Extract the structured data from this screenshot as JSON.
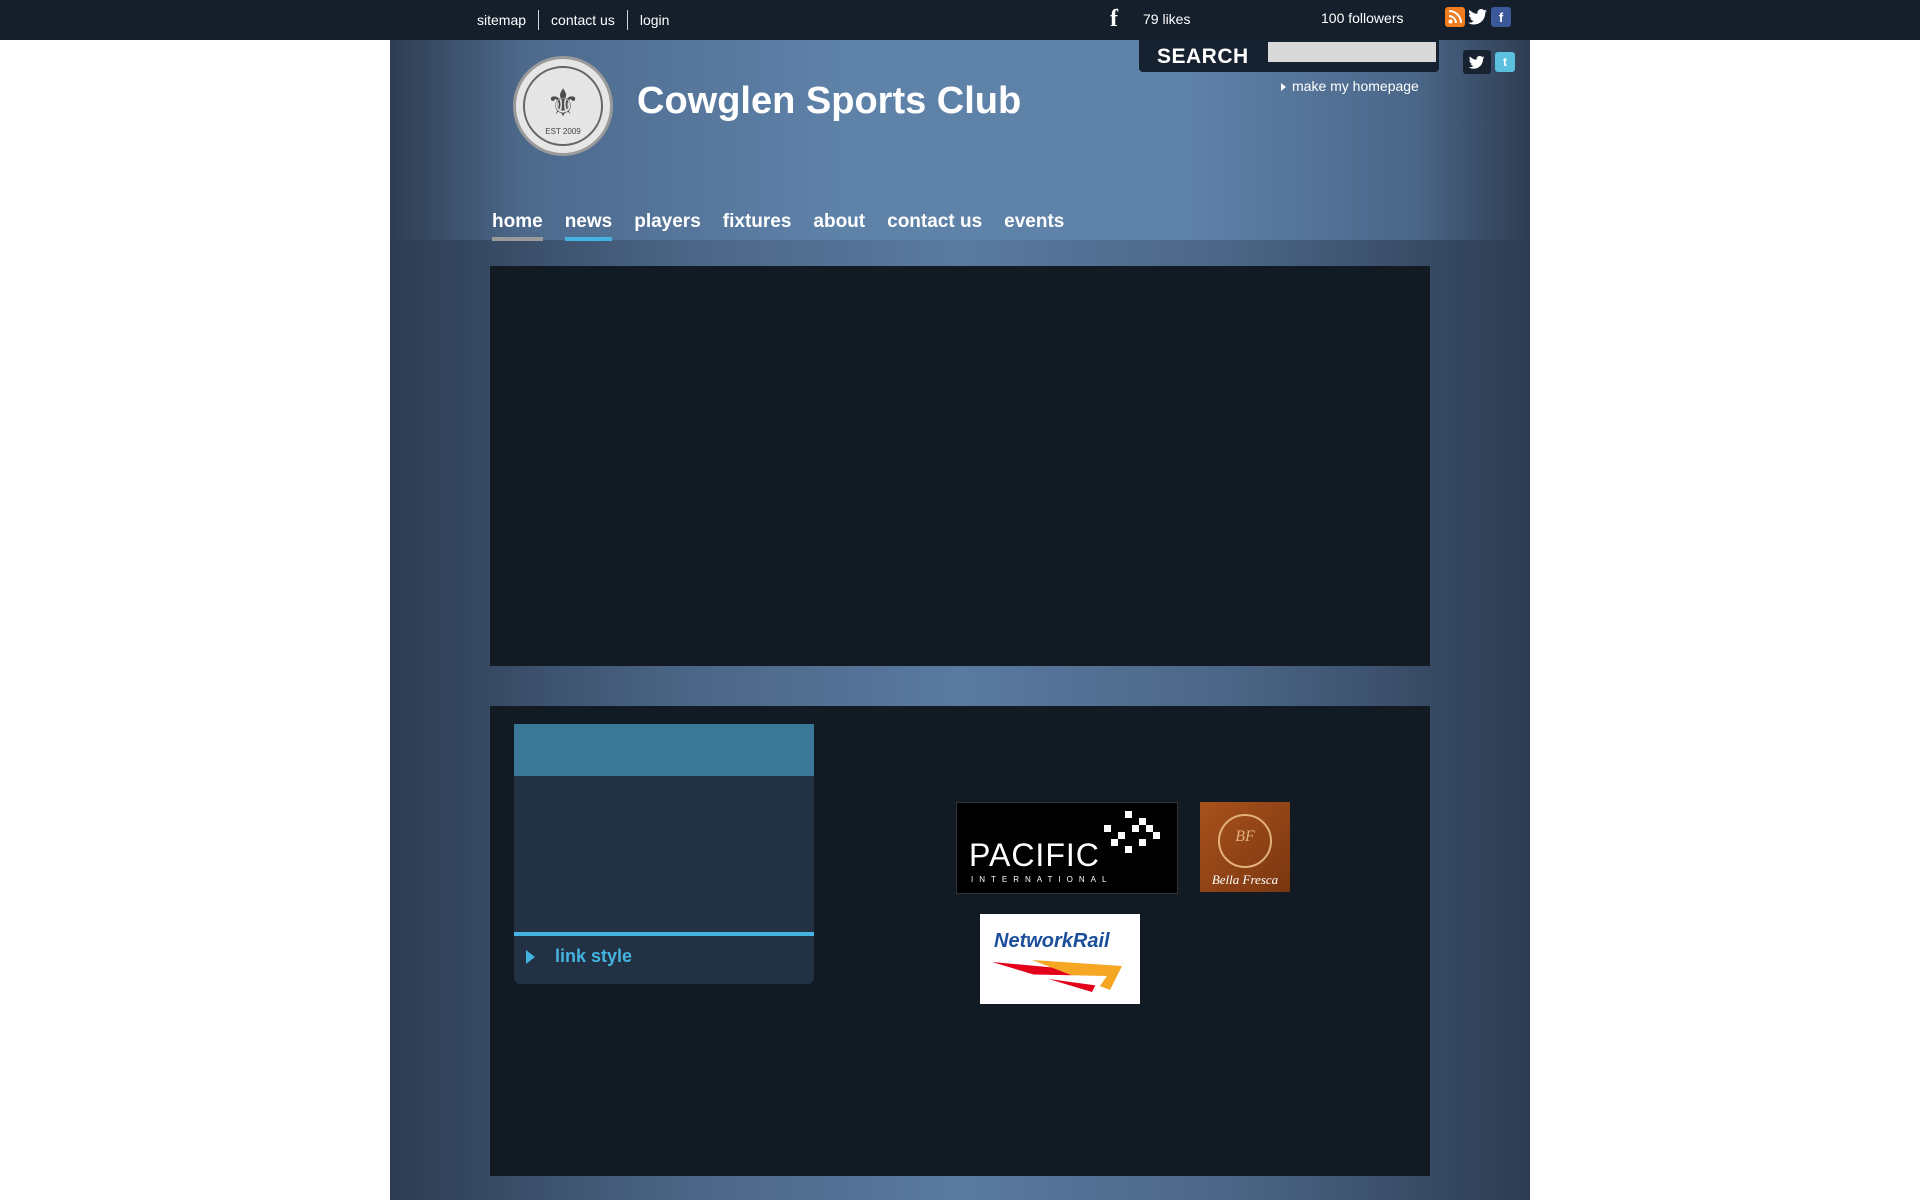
{
  "topbar": {
    "links": [
      "sitemap",
      "contact us",
      "login"
    ],
    "likes": "79 likes",
    "followers": "100 followers",
    "icons": [
      "rss-icon",
      "twitter-icon",
      "facebook-icon"
    ]
  },
  "header": {
    "site_title": "Cowglen Sports Club",
    "search_label": "SEARCH",
    "search_value": "",
    "make_homepage": "make my homepage",
    "crest_text": "EST 2009"
  },
  "nav": {
    "items": [
      "home",
      "news",
      "players",
      "fixtures",
      "about",
      "contact us",
      "events"
    ]
  },
  "widget": {
    "link_label": "link style"
  },
  "sponsors": {
    "pacific_name": "PACIFIC",
    "pacific_sub": "INTERNATIONAL",
    "bella_name": "Bella Fresca",
    "bella_monogram": "BF",
    "network_rail": "NetworkRail"
  },
  "colors": {
    "topbar": "#141f2b",
    "panel": "#121a24",
    "accent": "#45b3e0",
    "header_blue": "#5f82a9"
  }
}
